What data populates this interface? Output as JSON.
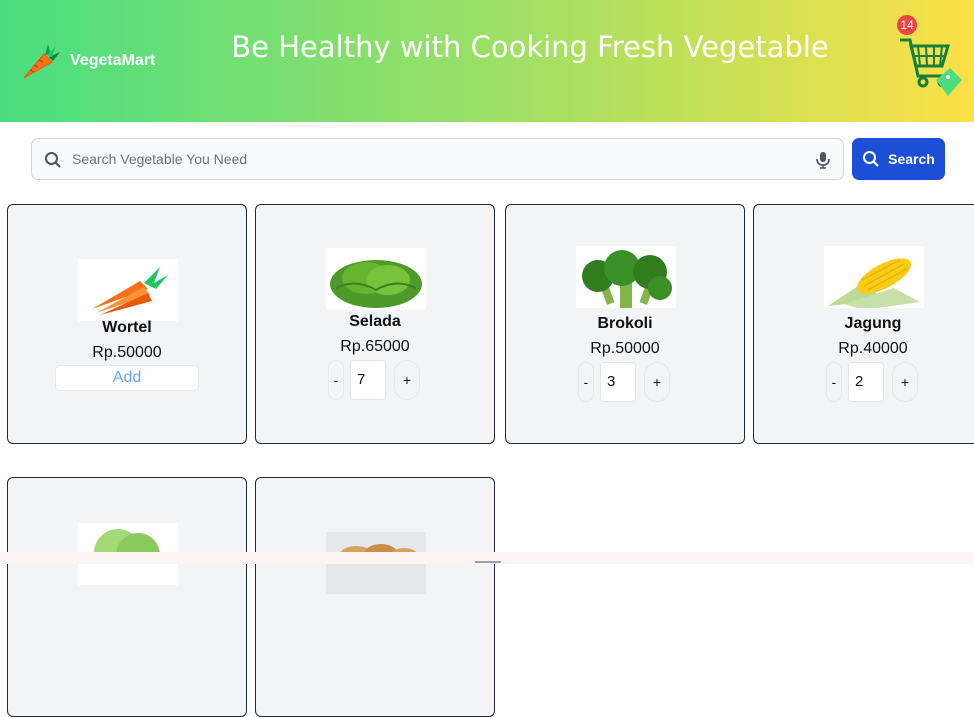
{
  "header": {
    "brand": "VegetaMart",
    "tagline": "Be Healthy with Cooking Fresh Vegetable",
    "cart_count": "14",
    "brand_icon": "carrot-icon",
    "cart_icon": "shopping-cart-icon"
  },
  "search": {
    "placeholder": "Search Vegetable You Need",
    "button_label": "Search"
  },
  "products": [
    {
      "name": "Wortel",
      "price": "Rp.50000",
      "action": "Add"
    },
    {
      "name": "Selada",
      "price": "Rp.65000",
      "qty_minus": "-",
      "qty": "7",
      "qty_plus": "+"
    },
    {
      "name": "Brokoli",
      "price": "Rp.50000",
      "qty_minus": "-",
      "qty": "3",
      "qty_plus": "+"
    },
    {
      "name": "Jagung",
      "price": "Rp.40000",
      "qty_minus": "-",
      "qty": "2",
      "qty_plus": "+"
    }
  ],
  "colors": {
    "header_start": "#4ade80",
    "header_end": "#fde047",
    "search_button": "#1d4ed8",
    "badge": "#ef4444",
    "add_text": "#60a5fa"
  }
}
